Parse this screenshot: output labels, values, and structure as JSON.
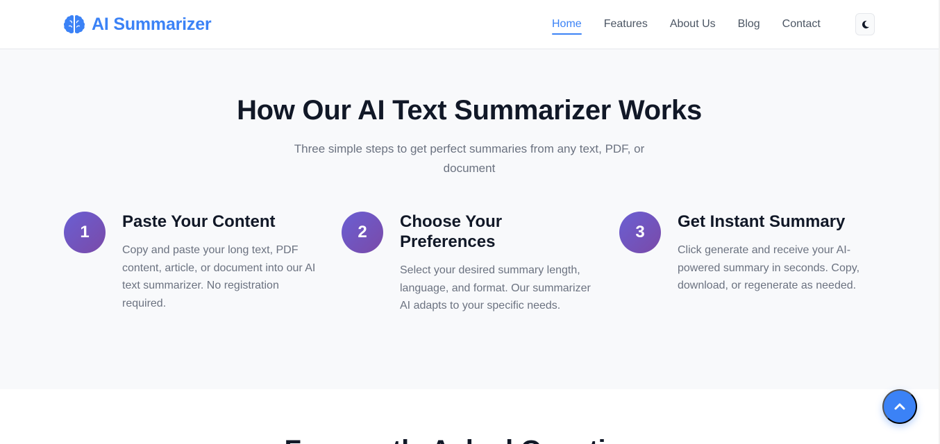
{
  "brand": {
    "name": "AI Summarizer",
    "icon": "brain-icon",
    "color": "#3b82f6"
  },
  "nav": {
    "items": [
      {
        "label": "Home",
        "active": true
      },
      {
        "label": "Features",
        "active": false
      },
      {
        "label": "About Us",
        "active": false
      },
      {
        "label": "Blog",
        "active": false
      },
      {
        "label": "Contact",
        "active": false
      }
    ],
    "theme_toggle_icon": "moon-icon"
  },
  "how_it_works": {
    "title": "How Our AI Text Summarizer Works",
    "subtitle": "Three simple steps to get perfect summaries from any text, PDF, or document",
    "steps": [
      {
        "number": "1",
        "title": "Paste Your Content",
        "description": "Copy and paste your long text, PDF content, article, or document into our AI text summarizer. No registration required."
      },
      {
        "number": "2",
        "title": "Choose Your Preferences",
        "description": "Select your desired summary length, language, and format. Our summarizer AI adapts to your specific needs."
      },
      {
        "number": "3",
        "title": "Get Instant Summary",
        "description": "Click generate and receive your AI-powered summary in seconds. Copy, download, or regenerate as needed."
      }
    ]
  },
  "faq": {
    "title": "Frequently Asked Questions"
  },
  "scroll_top": {
    "icon": "chevron-up-icon"
  },
  "colors": {
    "accent": "#3b82f6",
    "badge_gradient_start": "#6a5fd3",
    "badge_gradient_end": "#7a4aa8"
  }
}
